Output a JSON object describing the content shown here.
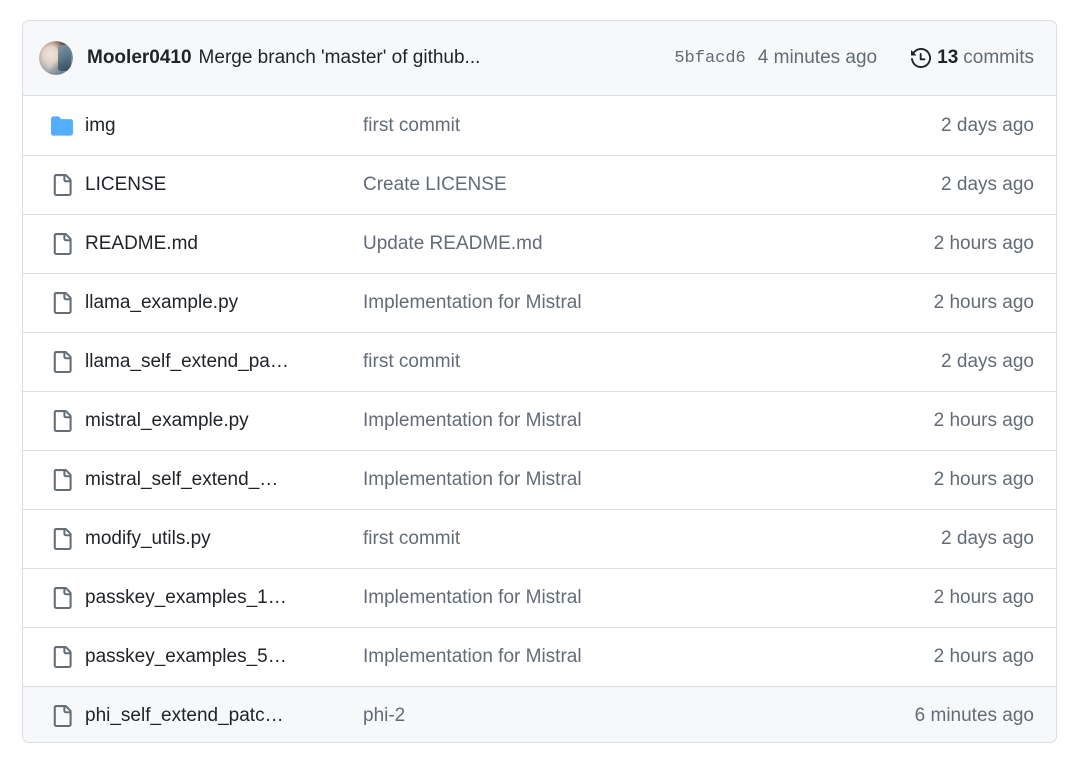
{
  "header": {
    "avatar_name": "avatar",
    "author": "Mooler0410",
    "commit_message": "Merge branch 'master' of github...",
    "commit_hash": "5bfacd6",
    "commit_time": "4 minutes ago",
    "history_icon": "history-icon",
    "commits_count": "13",
    "commits_word": "commits"
  },
  "colors": {
    "folder_icon": "#54aeff",
    "file_icon": "#656d76",
    "border": "#d8dee4",
    "header_bg": "#f6f8fa",
    "row_active_bg": "#f6f8fa",
    "text_primary": "#1f2328",
    "text_muted": "#636c76"
  },
  "files": [
    {
      "icon": "folder-icon",
      "type": "folder",
      "name": "img",
      "commit": "first commit",
      "time": "2 days ago",
      "active": false
    },
    {
      "icon": "file-icon",
      "type": "file",
      "name": "LICENSE",
      "commit": "Create LICENSE",
      "time": "2 days ago",
      "active": false
    },
    {
      "icon": "file-icon",
      "type": "file",
      "name": "README.md",
      "commit": "Update README.md",
      "time": "2 hours ago",
      "active": false
    },
    {
      "icon": "file-icon",
      "type": "file",
      "name": "llama_example.py",
      "commit": "Implementation for Mistral",
      "time": "2 hours ago",
      "active": false
    },
    {
      "icon": "file-icon",
      "type": "file",
      "name": "llama_self_extend_pa…",
      "commit": "first commit",
      "time": "2 days ago",
      "active": false
    },
    {
      "icon": "file-icon",
      "type": "file",
      "name": "mistral_example.py",
      "commit": "Implementation for Mistral",
      "time": "2 hours ago",
      "active": false
    },
    {
      "icon": "file-icon",
      "type": "file",
      "name": "mistral_self_extend_…",
      "commit": "Implementation for Mistral",
      "time": "2 hours ago",
      "active": false
    },
    {
      "icon": "file-icon",
      "type": "file",
      "name": "modify_utils.py",
      "commit": "first commit",
      "time": "2 days ago",
      "active": false
    },
    {
      "icon": "file-icon",
      "type": "file",
      "name": "passkey_examples_1…",
      "commit": "Implementation for Mistral",
      "time": "2 hours ago",
      "active": false
    },
    {
      "icon": "file-icon",
      "type": "file",
      "name": "passkey_examples_5…",
      "commit": "Implementation for Mistral",
      "time": "2 hours ago",
      "active": false
    },
    {
      "icon": "file-icon",
      "type": "file",
      "name": "phi_self_extend_patc…",
      "commit": "phi-2",
      "time": "6 minutes ago",
      "active": true
    }
  ]
}
